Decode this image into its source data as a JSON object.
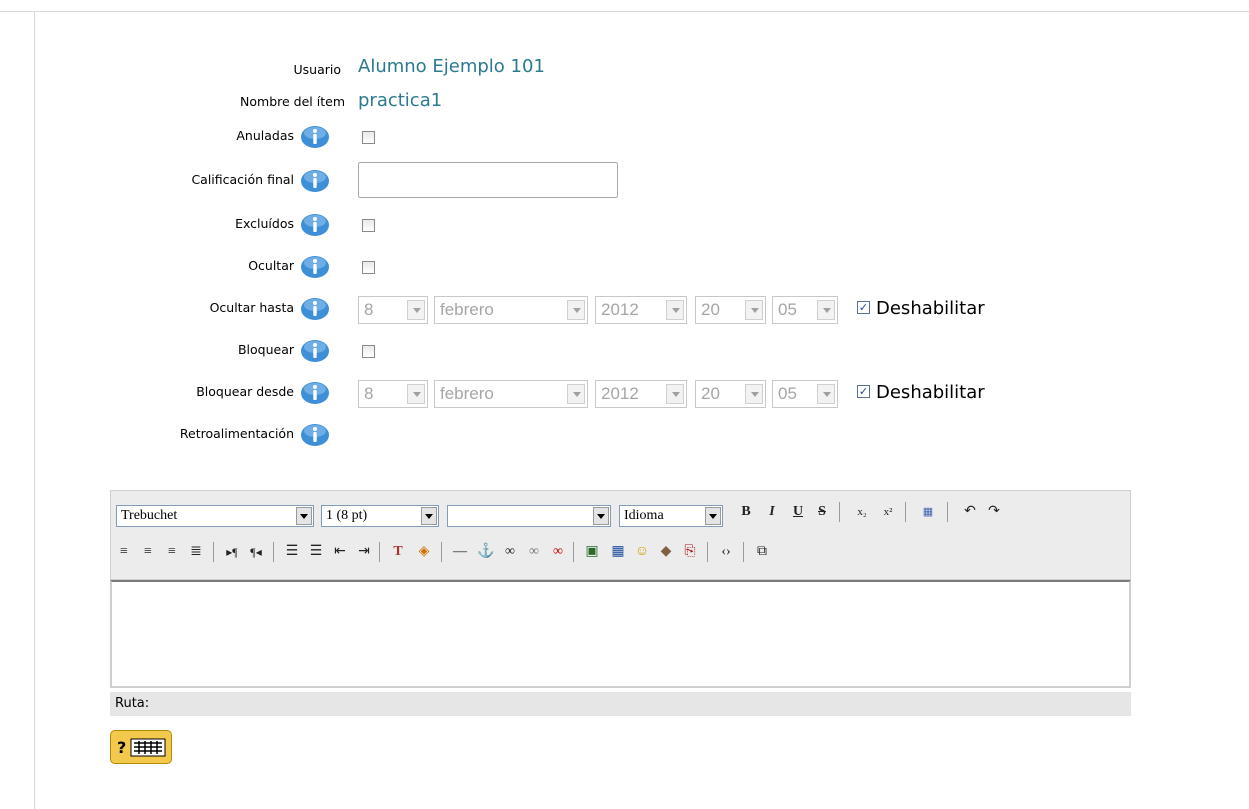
{
  "form": {
    "usuario": {
      "label": "Usuario",
      "value": "Alumno Ejemplo 101"
    },
    "nombre_item": {
      "label": "Nombre del ítem",
      "value": "practica1"
    },
    "anuladas": {
      "label": "Anuladas",
      "checked": false
    },
    "calificacion_final": {
      "label": "Calificación final",
      "value": ""
    },
    "excluidos": {
      "label": "Excluídos",
      "checked": false
    },
    "ocultar": {
      "label": "Ocultar",
      "checked": false
    },
    "ocultar_hasta": {
      "label": "Ocultar hasta",
      "day": "8",
      "month": "febrero",
      "year": "2012",
      "hour": "20",
      "minute": "05",
      "disable_label": "Deshabilitar",
      "disabled": true
    },
    "bloquear": {
      "label": "Bloquear",
      "checked": false
    },
    "bloquear_desde": {
      "label": "Bloquear desde",
      "day": "8",
      "month": "febrero",
      "year": "2012",
      "hour": "20",
      "minute": "05",
      "disable_label": "Deshabilitar",
      "disabled": true
    },
    "retroalimentacion": {
      "label": "Retroalimentación"
    }
  },
  "editor": {
    "font": "Trebuchet",
    "size": "1 (8 pt)",
    "format": "",
    "language": "Idioma",
    "path_label": "Ruta:",
    "content": ""
  },
  "colors": {
    "value_text": "#2b7a8f",
    "info_icon": "#3f8fd8",
    "toolbar_bg": "#ececec"
  }
}
